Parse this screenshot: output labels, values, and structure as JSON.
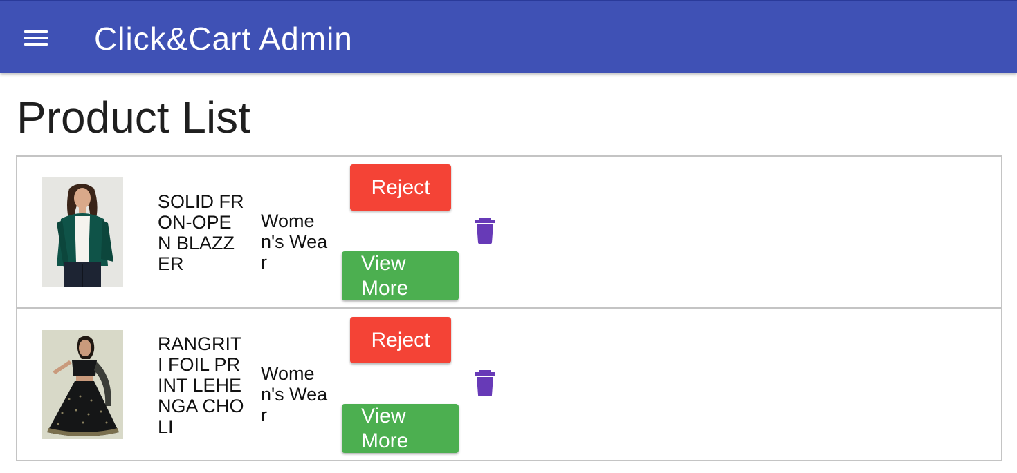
{
  "appbar": {
    "title": "Click&Cart Admin",
    "menu_icon": "hamburger-menu-icon",
    "color": "#3f51b5"
  },
  "page": {
    "title": "Product List"
  },
  "products": [
    {
      "name": "SOLID FRON-OPEN BLAZZER",
      "category": "Women's Wear",
      "reject_label": "Reject",
      "view_label": "View More",
      "delete_icon": "trash-icon"
    },
    {
      "name": "RANGRITI FOIL PRINT LEHENGA CHOLI",
      "category": "Women's Wear",
      "reject_label": "Reject",
      "view_label": "View More",
      "delete_icon": "trash-icon"
    }
  ],
  "colors": {
    "reject": "#f44336",
    "view_more": "#4caf50",
    "delete_icon": "#673ab7"
  }
}
